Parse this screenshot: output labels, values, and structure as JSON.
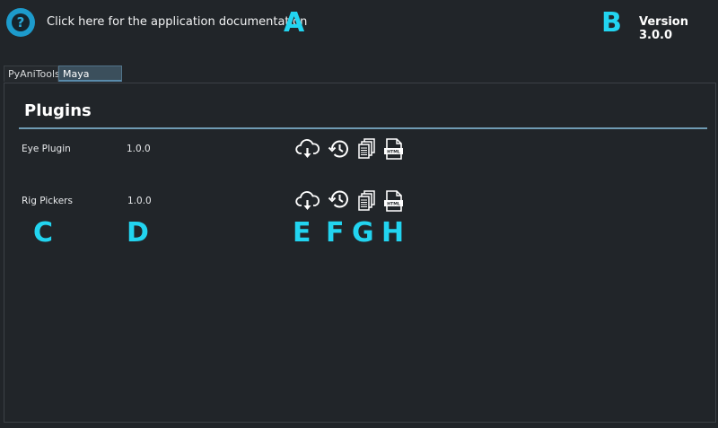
{
  "header": {
    "help_icon": "question-circle-icon",
    "doc_link": "Click here for the application documentation",
    "version": "Version 3.0.0"
  },
  "tabs": [
    {
      "label": "PyAniTools",
      "active": false
    },
    {
      "label": "Maya Plugins",
      "active": true
    }
  ],
  "section": {
    "title": "Plugins"
  },
  "plugins": [
    {
      "name": "Eye Plugin",
      "version": "1.0.0"
    },
    {
      "name": "Rig Pickers",
      "version": "1.0.0"
    }
  ],
  "actions": [
    {
      "icon": "cloud-download-icon"
    },
    {
      "icon": "history-icon"
    },
    {
      "icon": "documents-icon"
    },
    {
      "icon": "html-file-icon"
    }
  ],
  "markers": {
    "a": "A",
    "b": "B",
    "c": "C",
    "d": "D",
    "e": "E",
    "f": "F",
    "g": "G",
    "h": "H"
  },
  "colors": {
    "background": "#212529",
    "accent": "#1d9bcc",
    "marker": "#22d4f0",
    "tab_active": "#3b4f5c",
    "rule": "#6f9bb3"
  }
}
